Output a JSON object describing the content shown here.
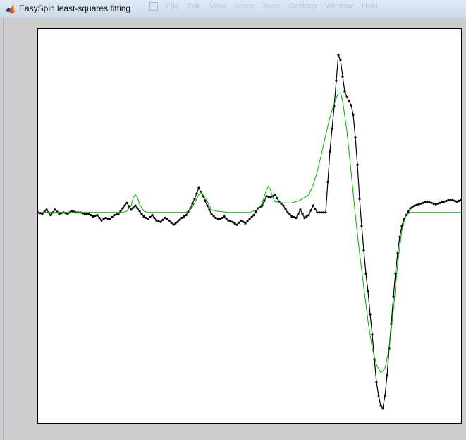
{
  "window": {
    "title": "EasySpin least-squares fitting",
    "icon": "matlab-icon"
  },
  "background_window_menu": [
    "File",
    "Edit",
    "View",
    "Insert",
    "Tools",
    "Desktop",
    "Window",
    "Help"
  ],
  "colors": {
    "experimental": "#000000",
    "fit": "#00b000",
    "figure_background": "#cdcdcd",
    "axes_background": "#ffffff"
  },
  "chart_data": {
    "type": "line",
    "title": "",
    "xlabel": "",
    "ylabel": "",
    "xlim": [
      0,
      1
    ],
    "ylim": [
      -1.55,
      1.35
    ],
    "grid": false,
    "ticks_visible": false,
    "series": [
      {
        "role": "experimental",
        "color": "#000000",
        "marker": "dot",
        "points": [
          [
            0.0,
            0.0
          ],
          [
            0.01,
            -0.01
          ],
          [
            0.02,
            0.02
          ],
          [
            0.03,
            -0.02
          ],
          [
            0.04,
            0.02
          ],
          [
            0.05,
            -0.01
          ],
          [
            0.06,
            0.0
          ],
          [
            0.07,
            -0.01
          ],
          [
            0.08,
            0.01
          ],
          [
            0.09,
            0.0
          ],
          [
            0.1,
            0.0
          ],
          [
            0.11,
            -0.01
          ],
          [
            0.12,
            -0.01
          ],
          [
            0.13,
            -0.03
          ],
          [
            0.14,
            -0.02
          ],
          [
            0.15,
            -0.06
          ],
          [
            0.16,
            -0.04
          ],
          [
            0.17,
            -0.05
          ],
          [
            0.18,
            -0.02
          ],
          [
            0.19,
            -0.01
          ],
          [
            0.2,
            0.03
          ],
          [
            0.21,
            0.07
          ],
          [
            0.22,
            0.02
          ],
          [
            0.23,
            0.05
          ],
          [
            0.24,
            0.01
          ],
          [
            0.25,
            -0.03
          ],
          [
            0.26,
            -0.05
          ],
          [
            0.27,
            -0.02
          ],
          [
            0.28,
            -0.06
          ],
          [
            0.29,
            -0.07
          ],
          [
            0.3,
            -0.04
          ],
          [
            0.31,
            -0.06
          ],
          [
            0.32,
            -0.09
          ],
          [
            0.33,
            -0.07
          ],
          [
            0.34,
            -0.04
          ],
          [
            0.35,
            -0.02
          ],
          [
            0.36,
            0.03
          ],
          [
            0.37,
            0.1
          ],
          [
            0.38,
            0.18
          ],
          [
            0.39,
            0.12
          ],
          [
            0.4,
            0.05
          ],
          [
            0.41,
            -0.01
          ],
          [
            0.42,
            -0.04
          ],
          [
            0.43,
            -0.05
          ],
          [
            0.44,
            -0.03
          ],
          [
            0.45,
            -0.06
          ],
          [
            0.46,
            -0.07
          ],
          [
            0.47,
            -0.09
          ],
          [
            0.48,
            -0.06
          ],
          [
            0.49,
            -0.08
          ],
          [
            0.5,
            -0.05
          ],
          [
            0.51,
            -0.02
          ],
          [
            0.52,
            0.03
          ],
          [
            0.53,
            0.05
          ],
          [
            0.54,
            0.12
          ],
          [
            0.55,
            0.11
          ],
          [
            0.56,
            0.13
          ],
          [
            0.57,
            0.08
          ],
          [
            0.58,
            0.05
          ],
          [
            0.59,
            0.0
          ],
          [
            0.6,
            -0.03
          ],
          [
            0.61,
            -0.04
          ],
          [
            0.62,
            0.02
          ],
          [
            0.63,
            -0.04
          ],
          [
            0.64,
            -0.02
          ],
          [
            0.65,
            0.05
          ],
          [
            0.66,
            0.0
          ],
          [
            0.67,
            0.0
          ],
          [
            0.68,
            0.0
          ],
          [
            0.69,
            0.45
          ],
          [
            0.7,
            0.78
          ],
          [
            0.705,
            0.97
          ],
          [
            0.71,
            1.16
          ],
          [
            0.715,
            1.12
          ],
          [
            0.72,
            1.0
          ],
          [
            0.725,
            0.89
          ],
          [
            0.73,
            0.85
          ],
          [
            0.735,
            0.82
          ],
          [
            0.74,
            0.79
          ],
          [
            0.745,
            0.72
          ],
          [
            0.75,
            0.55
          ],
          [
            0.755,
            0.35
          ],
          [
            0.76,
            0.1
          ],
          [
            0.765,
            -0.1
          ],
          [
            0.77,
            -0.28
          ],
          [
            0.775,
            -0.45
          ],
          [
            0.78,
            -0.58
          ],
          [
            0.785,
            -0.75
          ],
          [
            0.79,
            -0.9
          ],
          [
            0.795,
            -1.08
          ],
          [
            0.8,
            -1.25
          ],
          [
            0.805,
            -1.35
          ],
          [
            0.81,
            -1.42
          ],
          [
            0.815,
            -1.44
          ],
          [
            0.82,
            -1.35
          ],
          [
            0.825,
            -1.2
          ],
          [
            0.83,
            -1.0
          ],
          [
            0.835,
            -0.82
          ],
          [
            0.84,
            -0.62
          ],
          [
            0.845,
            -0.45
          ],
          [
            0.85,
            -0.3
          ],
          [
            0.855,
            -0.18
          ],
          [
            0.86,
            -0.1
          ],
          [
            0.865,
            -0.05
          ],
          [
            0.87,
            -0.02
          ],
          [
            0.88,
            0.03
          ],
          [
            0.89,
            0.05
          ],
          [
            0.9,
            0.06
          ],
          [
            0.91,
            0.07
          ],
          [
            0.92,
            0.08
          ],
          [
            0.93,
            0.07
          ],
          [
            0.94,
            0.06
          ],
          [
            0.95,
            0.07
          ],
          [
            0.96,
            0.08
          ],
          [
            0.97,
            0.09
          ],
          [
            0.98,
            0.09
          ],
          [
            0.99,
            0.08
          ],
          [
            1.0,
            0.09
          ]
        ]
      },
      {
        "role": "fit",
        "color": "#00b000",
        "marker": "none",
        "points": [
          [
            0.0,
            0.0
          ],
          [
            0.1,
            0.0
          ],
          [
            0.2,
            0.0
          ],
          [
            0.21,
            0.01
          ],
          [
            0.22,
            0.05
          ],
          [
            0.225,
            0.11
          ],
          [
            0.23,
            0.13
          ],
          [
            0.235,
            0.11
          ],
          [
            0.24,
            0.06
          ],
          [
            0.25,
            0.01
          ],
          [
            0.26,
            0.0
          ],
          [
            0.3,
            0.0
          ],
          [
            0.35,
            0.0
          ],
          [
            0.365,
            0.04
          ],
          [
            0.37,
            0.07
          ],
          [
            0.375,
            0.1
          ],
          [
            0.38,
            0.13
          ],
          [
            0.385,
            0.15
          ],
          [
            0.39,
            0.13
          ],
          [
            0.4,
            0.08
          ],
          [
            0.41,
            0.02
          ],
          [
            0.42,
            0.01
          ],
          [
            0.45,
            0.0
          ],
          [
            0.5,
            0.0
          ],
          [
            0.52,
            0.02
          ],
          [
            0.53,
            0.07
          ],
          [
            0.535,
            0.12
          ],
          [
            0.54,
            0.17
          ],
          [
            0.545,
            0.19
          ],
          [
            0.55,
            0.16
          ],
          [
            0.555,
            0.11
          ],
          [
            0.56,
            0.08
          ],
          [
            0.58,
            0.07
          ],
          [
            0.6,
            0.07
          ],
          [
            0.62,
            0.09
          ],
          [
            0.64,
            0.13
          ],
          [
            0.65,
            0.2
          ],
          [
            0.66,
            0.3
          ],
          [
            0.67,
            0.43
          ],
          [
            0.68,
            0.57
          ],
          [
            0.69,
            0.7
          ],
          [
            0.7,
            0.8
          ],
          [
            0.71,
            0.88
          ],
          [
            0.715,
            0.88
          ],
          [
            0.72,
            0.82
          ],
          [
            0.73,
            0.6
          ],
          [
            0.74,
            0.3
          ],
          [
            0.75,
            -0.02
          ],
          [
            0.76,
            -0.3
          ],
          [
            0.77,
            -0.55
          ],
          [
            0.78,
            -0.8
          ],
          [
            0.79,
            -1.0
          ],
          [
            0.8,
            -1.12
          ],
          [
            0.81,
            -1.18
          ],
          [
            0.82,
            -1.15
          ],
          [
            0.83,
            -1.0
          ],
          [
            0.84,
            -0.72
          ],
          [
            0.85,
            -0.38
          ],
          [
            0.86,
            -0.13
          ],
          [
            0.87,
            -0.02
          ],
          [
            0.88,
            0.0
          ],
          [
            0.9,
            0.0
          ],
          [
            1.0,
            0.0
          ]
        ]
      }
    ]
  }
}
